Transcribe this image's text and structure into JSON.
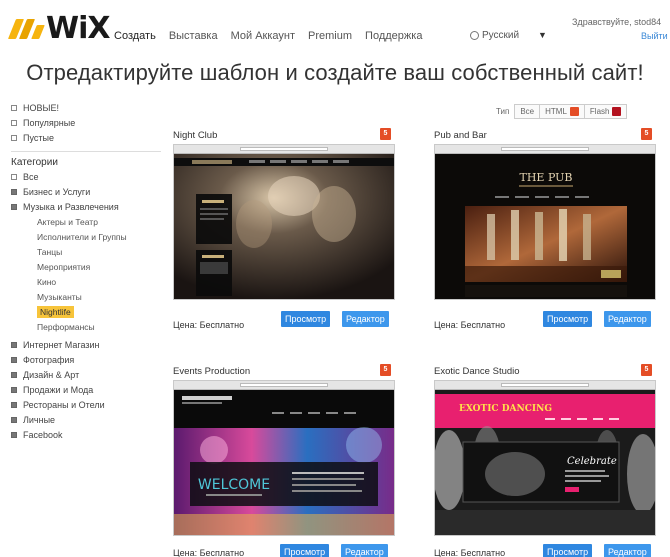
{
  "header": {
    "logo_text": "WiX",
    "nav": [
      "Создать",
      "Выставка",
      "Мой Аккаунт",
      "Premium",
      "Поддержка"
    ],
    "language": "Русский",
    "greeting": "Здравствуйте, stod84",
    "logout": "Выйти"
  },
  "headline": "Отредактируйте шаблон и создайте ваш собственный сайт!",
  "sidebar": {
    "top_items": [
      "НОВЫЕ!",
      "Популярные",
      "Пустые"
    ],
    "categories_label": "Категории",
    "categories": [
      {
        "label": "Все",
        "filled": false
      },
      {
        "label": "Бизнес и Услуги",
        "filled": true
      },
      {
        "label": "Музыка и Развлечения",
        "filled": true
      }
    ],
    "subcategories": [
      "Актеры и Театр",
      "Исполнители и Группы",
      "Танцы",
      "Мероприятия",
      "Кино",
      "Музыканты",
      "Nightlife",
      "Перформансы"
    ],
    "selected_subcategory": "Nightlife",
    "more_categories": [
      "Интернет Магазин",
      "Фотография",
      "Дизайн & Арт",
      "Продажи и Мода",
      "Рестораны и Отели",
      "Личные",
      "Facebook"
    ]
  },
  "filter": {
    "label": "Тип",
    "options": [
      "Все",
      "HTML",
      "Flash"
    ]
  },
  "templates": [
    {
      "name": "Night Club",
      "price": "Цена: Бесплатно",
      "view": "Просмотр",
      "edit": "Редактор",
      "badge": "5",
      "site_title": "",
      "accent": "#d9c27a"
    },
    {
      "name": "Pub and Bar",
      "price": "Цена: Бесплатно",
      "view": "Просмотр",
      "edit": "Редактор",
      "badge": "5",
      "site_title": "THE PUB",
      "accent": "#c9a55a"
    },
    {
      "name": "Events Production",
      "price": "Цена: Бесплатно",
      "view": "Просмотр",
      "edit": "Редактор",
      "badge": "5",
      "site_title": "WELCOME",
      "accent": "#4fc6d8"
    },
    {
      "name": "Exotic Dance Studio",
      "price": "Цена: Бесплатно",
      "view": "Просмотр",
      "edit": "Редактор",
      "badge": "5",
      "site_title": "EXOTIC DANCING",
      "accent": "#e8206f"
    }
  ],
  "colors": {
    "button_blue": "#2f87e0",
    "selected_highlight": "#f7c43a",
    "html5_badge": "#e44d26",
    "link_blue": "#3a88d6"
  },
  "icons": {
    "html5": "html5-icon",
    "flash": "flash-icon",
    "globe": "globe-icon",
    "dropdown": "caret-down-icon"
  }
}
